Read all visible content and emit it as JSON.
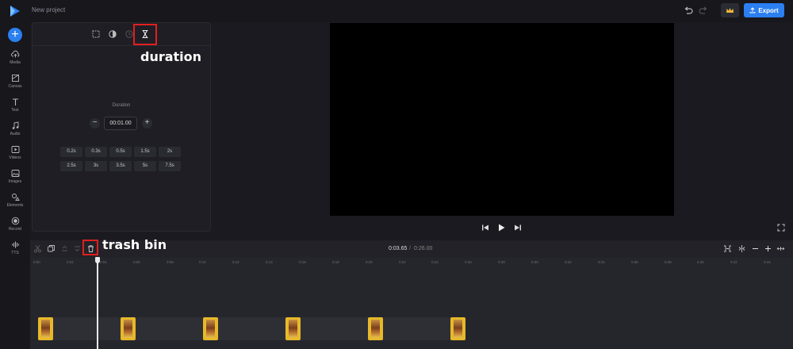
{
  "app": {
    "project_name": "New project",
    "export_label": "Export"
  },
  "sidebar": {
    "items": [
      {
        "label": "Media",
        "icon": "cloud-upload-icon"
      },
      {
        "label": "Canvas",
        "icon": "canvas-icon"
      },
      {
        "label": "Text",
        "icon": "text-icon"
      },
      {
        "label": "Audio",
        "icon": "music-note-icon"
      },
      {
        "label": "Videos",
        "icon": "video-icon"
      },
      {
        "label": "Images",
        "icon": "image-icon"
      },
      {
        "label": "Elements",
        "icon": "shapes-icon"
      },
      {
        "label": "Record",
        "icon": "record-icon"
      },
      {
        "label": "TTS",
        "icon": "waveform-icon"
      }
    ]
  },
  "panel": {
    "tabs": [
      "crop-icon",
      "adjust-icon",
      "speed-icon",
      "duration-icon"
    ],
    "duration_title": "Duration",
    "duration_value": "00:01.00",
    "presets": [
      "0.2s",
      "0.3s",
      "0.5s",
      "1.5s",
      "2s",
      "2.5s",
      "3s",
      "3.5s",
      "5s",
      "7.5s"
    ]
  },
  "timeline": {
    "current_time": "0:03.65",
    "separator": "/",
    "total_time": "0:26.00",
    "ticks": [
      "0:00",
      "0:02",
      "0:04",
      "0:06",
      "0:08",
      "0:10",
      "0:12",
      "0:14",
      "0:16",
      "0:18",
      "0:20",
      "0:22",
      "0:24",
      "0:26",
      "0:28",
      "0:30",
      "0:32",
      "0:34",
      "0:36",
      "0:38",
      "0:40",
      "0:42",
      "0:44"
    ]
  },
  "annotations": {
    "duration_label": "duration",
    "trash_label": "trash bin",
    "color": "#e02020"
  }
}
